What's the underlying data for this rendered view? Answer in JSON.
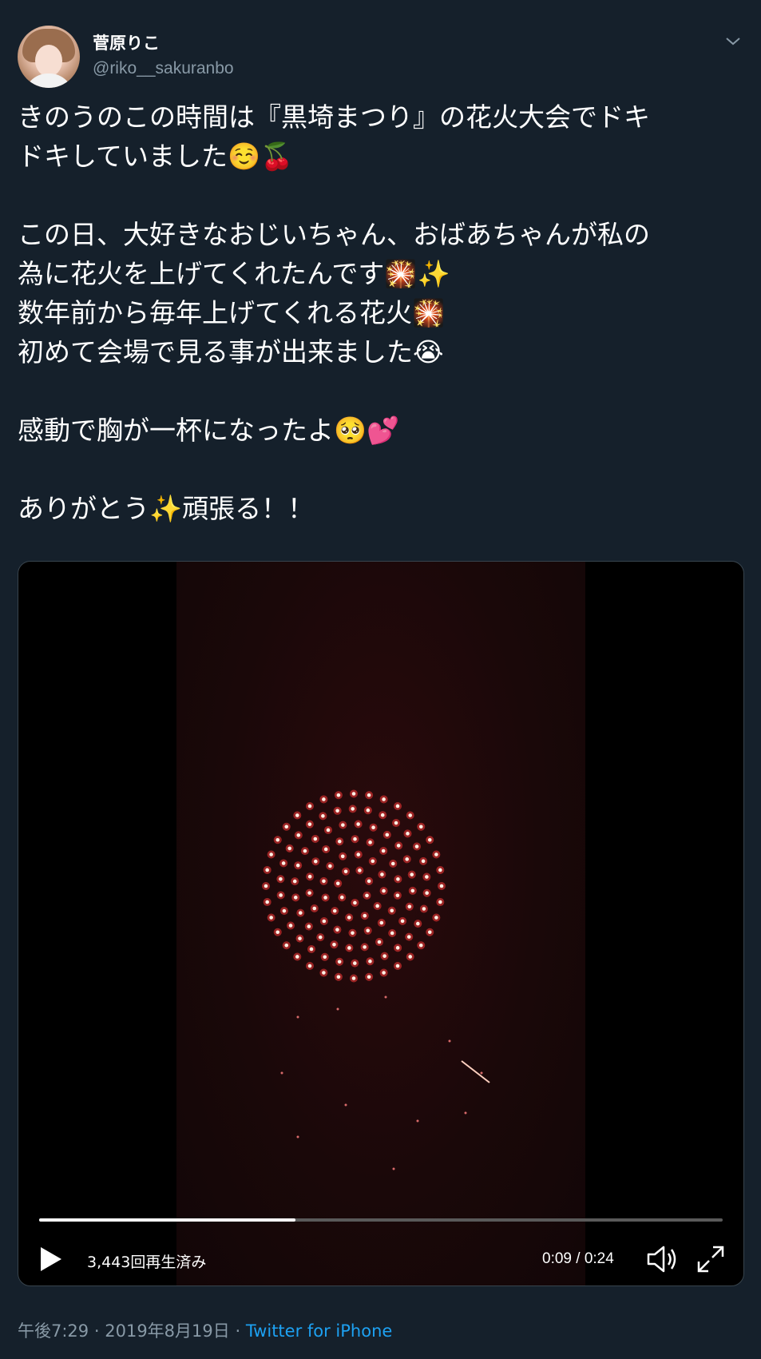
{
  "author": {
    "display_name": "菅原りこ",
    "handle": "@riko__sakuranbo"
  },
  "tweet": {
    "lines": [
      "きのうのこの時間は『黒埼まつり』の花火大会でドキ",
      "ドキしていました☺️🍒",
      "",
      "この日、大好きなおじいちゃん、おばあちゃんが私の",
      "為に花火を上げてくれたんです🎇✨",
      "数年前から毎年上げてくれる花火🎇",
      "初めて会場で見る事が出来ました😭",
      "",
      "感動で胸が一杯になったよ🥺💕",
      "",
      "ありがとう✨頑張る！！"
    ]
  },
  "video": {
    "views": "3,443回再生済み",
    "time": "0:09 / 0:24",
    "progress": 0.375
  },
  "meta": {
    "time": "午後7:29",
    "separator1": "·",
    "date": "2019年8月19日",
    "separator2": "·",
    "source": "Twitter for iPhone"
  },
  "colors": {
    "background": "#15202b",
    "secondary_text": "#8899a6",
    "link": "#1da1f2",
    "border": "#38444d"
  },
  "icons": [
    "chevron-down-icon",
    "play-icon",
    "volume-icon",
    "fullscreen-icon"
  ]
}
